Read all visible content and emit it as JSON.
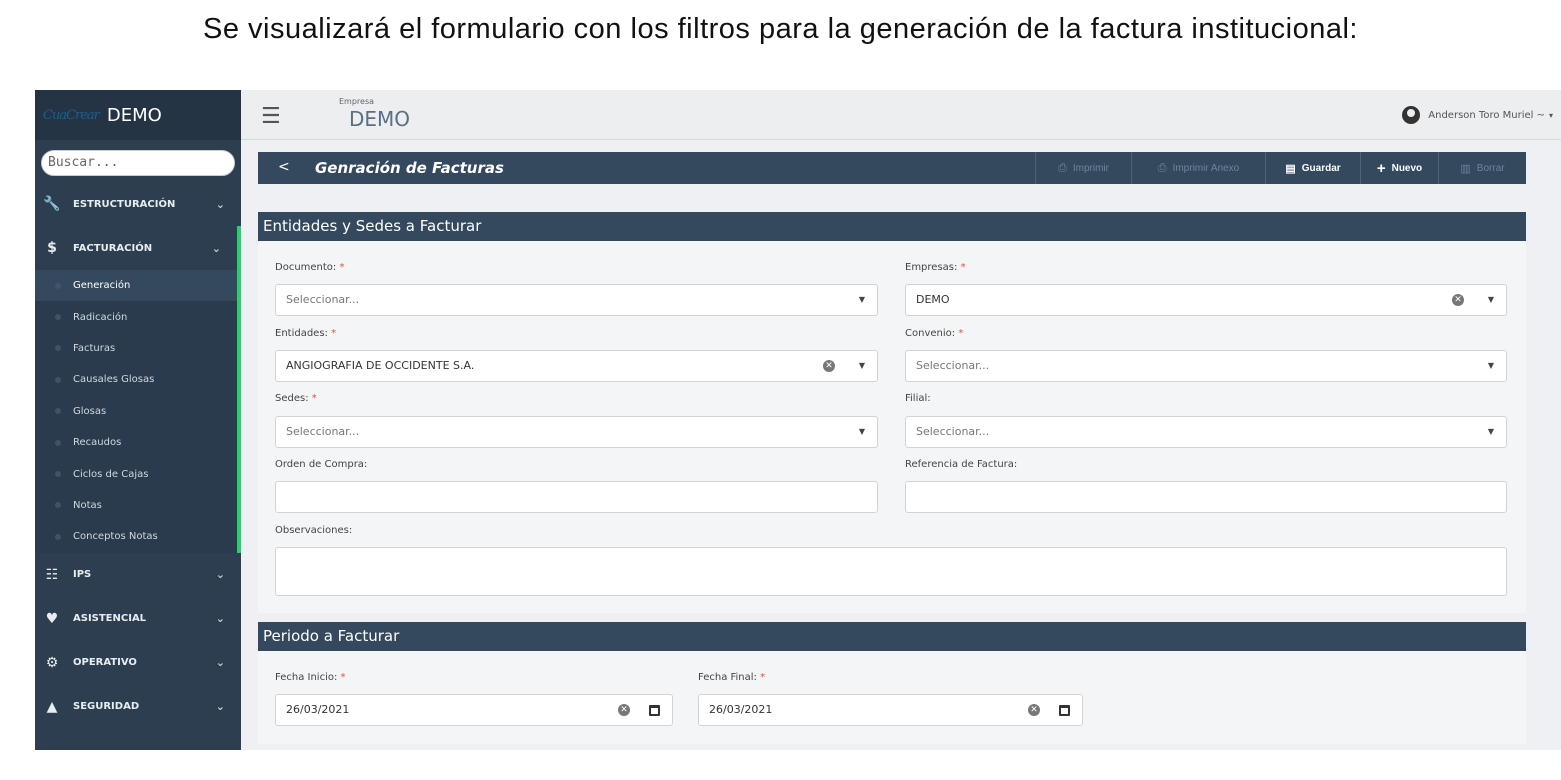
{
  "caption": "Se visualizará el formulario con los filtros para la generación de la factura institucional:",
  "sidebar": {
    "logo_text": "CuaCrear",
    "brand": "DEMO",
    "search_placeholder": "Buscar...",
    "sections": [
      {
        "label": "ESTRUCTURACIÓN",
        "icon": "wrench-icon"
      },
      {
        "label": "FACTURACIÓN",
        "icon": "dollar-icon"
      },
      {
        "label": "IPS",
        "icon": "hospital-icon"
      },
      {
        "label": "ASISTENCIAL",
        "icon": "heart-icon"
      },
      {
        "label": "OPERATIVO",
        "icon": "gears-icon"
      },
      {
        "label": "SEGURIDAD",
        "icon": "lock-icon"
      }
    ],
    "facturacion_items": [
      "Generación",
      "Radicación",
      "Facturas",
      "Causales Glosas",
      "Glosas",
      "Recaudos",
      "Ciclos de Cajas",
      "Notas",
      "Conceptos Notas"
    ],
    "accent_color": "#2ecc71"
  },
  "topbar": {
    "company_label": "Empresa",
    "company_name": "DEMO",
    "user_name": "Anderson Toro Muriel ~"
  },
  "titlebar": {
    "back": "<",
    "title": "Genración de Facturas",
    "buttons": {
      "imprimir": "Imprimir",
      "imprimir_anexo": "Imprimir Anexo",
      "guardar": "Guardar",
      "nuevo": "Nuevo",
      "borrar": "Borrar"
    }
  },
  "section1": {
    "title": "Entidades y Sedes a Facturar",
    "documento": {
      "label": "Documento:",
      "req": "*",
      "value": "Seleccionar..."
    },
    "empresas": {
      "label": "Empresas:",
      "req": "*",
      "value": "DEMO"
    },
    "entidades": {
      "label": "Entidades:",
      "req": "*",
      "value": "ANGIOGRAFIA DE OCCIDENTE S.A."
    },
    "convenio": {
      "label": "Convenio:",
      "req": "*",
      "value": "Seleccionar..."
    },
    "sedes": {
      "label": "Sedes:",
      "req": "*",
      "value": "Seleccionar..."
    },
    "filial": {
      "label": "Filial:",
      "value": "Seleccionar..."
    },
    "orden_compra": {
      "label": "Orden de Compra:",
      "value": ""
    },
    "referencia": {
      "label": "Referencia de Factura:",
      "value": ""
    },
    "observaciones": {
      "label": "Observaciones:",
      "value": ""
    }
  },
  "section2": {
    "title": "Periodo a Facturar",
    "fecha_inicio": {
      "label": "Fecha Inicio:",
      "req": "*",
      "value": "26/03/2021"
    },
    "fecha_final": {
      "label": "Fecha Final:",
      "req": "*",
      "value": "26/03/2021"
    }
  }
}
